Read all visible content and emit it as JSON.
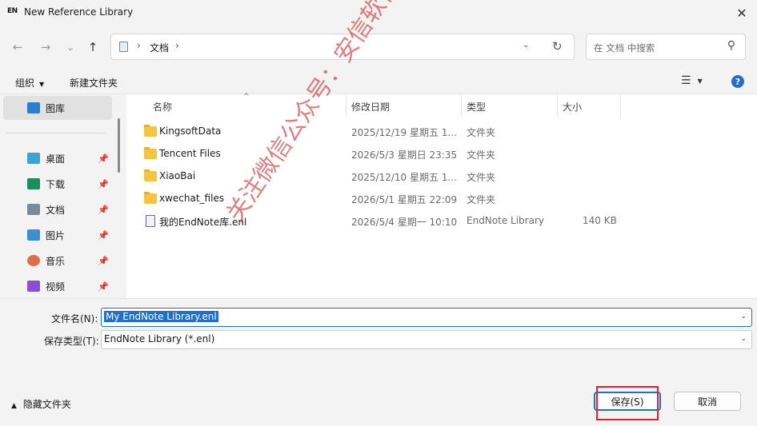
{
  "window": {
    "app_icon_text": "EN",
    "title": "New Reference Library",
    "close_glyph": "✕"
  },
  "nav": {
    "back_glyph": "←",
    "forward_glyph": "→",
    "recent_glyph": "⌄",
    "up_glyph": "↑",
    "crumb_sep": "›",
    "breadcrumb": "文档",
    "dropdown_glyph": "⌄",
    "refresh_glyph": "↻",
    "search_placeholder": "在 文档 中搜索",
    "search_glyph": "⚲"
  },
  "toolbar": {
    "organize": "组织",
    "organize_caret": "▼",
    "new_folder": "新建文件夹",
    "view_glyph": "☰",
    "view_caret": "▼",
    "help_glyph": "?"
  },
  "sidebar": {
    "pin_glyph": "📌",
    "items": [
      {
        "label": "图库",
        "icon": "gallery-icon",
        "color": "#2a7fd4"
      },
      {
        "label": "桌面",
        "icon": "desktop-icon",
        "color": "#3aa3d9"
      },
      {
        "label": "下载",
        "icon": "download-icon",
        "color": "#1a8f5a"
      },
      {
        "label": "文档",
        "icon": "documents-icon",
        "color": "#7a8a9a"
      },
      {
        "label": "图片",
        "icon": "pictures-icon",
        "color": "#3b8fd8"
      },
      {
        "label": "音乐",
        "icon": "music-icon",
        "color": "#e26b4a"
      },
      {
        "label": "视频",
        "icon": "videos-icon",
        "color": "#8a4fd6"
      }
    ]
  },
  "list": {
    "columns": {
      "name": "名称",
      "date": "修改日期",
      "type": "类型",
      "size": "大小"
    },
    "sort_glyph": "^",
    "files": [
      {
        "name": "KingsoftData",
        "date": "2025/12/19 星期五 1...",
        "type": "文件夹",
        "size": "",
        "kind": "folder"
      },
      {
        "name": "Tencent Files",
        "date": "2026/5/3 星期日 23:35",
        "type": "文件夹",
        "size": "",
        "kind": "folder"
      },
      {
        "name": "XiaoBai",
        "date": "2025/12/10 星期五 1...",
        "type": "文件夹",
        "size": "",
        "kind": "folder"
      },
      {
        "name": "xwechat_files",
        "date": "2026/5/1 星期五 22:09",
        "type": "文件夹",
        "size": "",
        "kind": "folder"
      },
      {
        "name": "我的EndNote库.enl",
        "date": "2026/5/4 星期一 10:10",
        "type": "EndNote Library",
        "size": "140 KB",
        "kind": "enl"
      }
    ]
  },
  "form": {
    "filename_label": "文件名(N):",
    "filename_value": "My EndNote Library.enl",
    "filetype_label": "保存类型(T):",
    "filetype_value": "EndNote Library (*.enl)",
    "dd_glyph": "⌄"
  },
  "footer": {
    "hide_folders": "隐藏文件夹",
    "hide_caret": "▲",
    "save": "保存(S)",
    "cancel": "取消"
  },
  "watermark": "关注微信公众号：安信软件管家",
  "colors": {
    "accent": "#1f6fd1",
    "highlight_box": "#e3212e",
    "watermark": "#d22828"
  }
}
